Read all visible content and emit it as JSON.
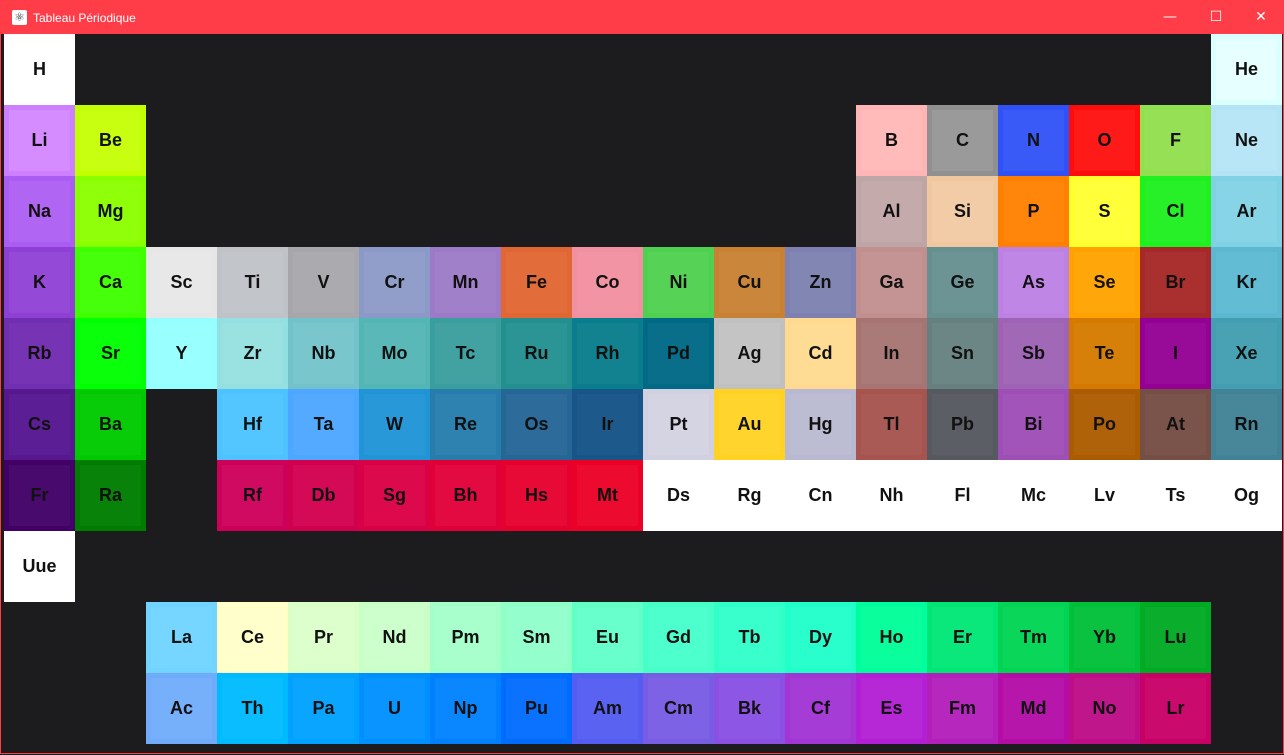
{
  "window": {
    "title": "Tableau Périodique",
    "app_icon": "atom-icon",
    "controls": {
      "minimize": "—",
      "maximize": "☐",
      "close": "✕"
    },
    "accent_color": "#ff3d49",
    "background_color": "#1c1b1e"
  },
  "elements": [
    {
      "symbol": "H",
      "color": "#ffffff",
      "inner": "#ffffff",
      "row": 1,
      "col": 1
    },
    {
      "symbol": "He",
      "color": "#d9ffff",
      "inner": "#e6ffff",
      "row": 1,
      "col": 18
    },
    {
      "symbol": "Li",
      "color": "#cc80ff",
      "inner": "#d48cff",
      "row": 2,
      "col": 1
    },
    {
      "symbol": "Be",
      "color": "#c2ff00",
      "inner": "#c8ff10",
      "row": 2,
      "col": 2
    },
    {
      "symbol": "B",
      "color": "#ffb5b5",
      "inner": "#ffbaba",
      "row": 2,
      "col": 13
    },
    {
      "symbol": "C",
      "color": "#909090",
      "inner": "#9a9a9a",
      "row": 2,
      "col": 14
    },
    {
      "symbol": "N",
      "color": "#3050f8",
      "inner": "#3a5af8",
      "row": 2,
      "col": 15
    },
    {
      "symbol": "O",
      "color": "#ff0d0d",
      "inner": "#ff1a1a",
      "row": 2,
      "col": 16
    },
    {
      "symbol": "F",
      "color": "#90e050",
      "inner": "#96e056",
      "row": 2,
      "col": 17
    },
    {
      "symbol": "Ne",
      "color": "#b3e3f5",
      "inner": "#b8e6f6",
      "row": 2,
      "col": 18
    },
    {
      "symbol": "Na",
      "color": "#ab5cf2",
      "inner": "#b066f2",
      "row": 3,
      "col": 1
    },
    {
      "symbol": "Mg",
      "color": "#8aff00",
      "inner": "#90ff0a",
      "row": 3,
      "col": 2
    },
    {
      "symbol": "Al",
      "color": "#bfa6a6",
      "inner": "#c4aaaa",
      "row": 3,
      "col": 13
    },
    {
      "symbol": "Si",
      "color": "#f0c8a0",
      "inner": "#f2cca6",
      "row": 3,
      "col": 14
    },
    {
      "symbol": "P",
      "color": "#ff8000",
      "inner": "#ff860a",
      "row": 3,
      "col": 15
    },
    {
      "symbol": "S",
      "color": "#ffff30",
      "inner": "#ffff3a",
      "row": 3,
      "col": 16
    },
    {
      "symbol": "Cl",
      "color": "#1ff01f",
      "inner": "#28f028",
      "row": 3,
      "col": 17
    },
    {
      "symbol": "Ar",
      "color": "#80d1e3",
      "inner": "#86d4e5",
      "row": 3,
      "col": 18
    },
    {
      "symbol": "K",
      "color": "#8f40d4",
      "inner": "#944ad6",
      "row": 4,
      "col": 1
    },
    {
      "symbol": "Ca",
      "color": "#3dff00",
      "inner": "#46ff0a",
      "row": 4,
      "col": 2
    },
    {
      "symbol": "Sc",
      "color": "#e6e6e6",
      "inner": "#e8e8e8",
      "row": 4,
      "col": 3
    },
    {
      "symbol": "Ti",
      "color": "#bfc2c7",
      "inner": "#c2c5ca",
      "row": 4,
      "col": 4
    },
    {
      "symbol": "V",
      "color": "#a6a6ab",
      "inner": "#aaaaaf",
      "row": 4,
      "col": 5
    },
    {
      "symbol": "Cr",
      "color": "#8a99c7",
      "inner": "#909ec9",
      "row": 4,
      "col": 6
    },
    {
      "symbol": "Mn",
      "color": "#9c7ac7",
      "inner": "#a080c9",
      "row": 4,
      "col": 7
    },
    {
      "symbol": "Fe",
      "color": "#e06633",
      "inner": "#e26c3a",
      "row": 4,
      "col": 8
    },
    {
      "symbol": "Co",
      "color": "#f090a0",
      "inner": "#f294a4",
      "row": 4,
      "col": 9
    },
    {
      "symbol": "Ni",
      "color": "#50d050",
      "inner": "#56d256",
      "row": 4,
      "col": 10
    },
    {
      "symbol": "Cu",
      "color": "#c88033",
      "inner": "#ca863a",
      "row": 4,
      "col": 11
    },
    {
      "symbol": "Zn",
      "color": "#7d80b0",
      "inner": "#8286b3",
      "row": 4,
      "col": 12
    },
    {
      "symbol": "Ga",
      "color": "#c28f8f",
      "inner": "#c49494",
      "row": 4,
      "col": 13
    },
    {
      "symbol": "Ge",
      "color": "#668f8f",
      "inner": "#6c9494",
      "row": 4,
      "col": 14
    },
    {
      "symbol": "As",
      "color": "#bd80e3",
      "inner": "#c086e5",
      "row": 4,
      "col": 15
    },
    {
      "symbol": "Se",
      "color": "#ffa100",
      "inner": "#ffa60a",
      "row": 4,
      "col": 16
    },
    {
      "symbol": "Br",
      "color": "#a62929",
      "inner": "#aa3030",
      "row": 4,
      "col": 17
    },
    {
      "symbol": "Kr",
      "color": "#5cb8d1",
      "inner": "#62bcd4",
      "row": 4,
      "col": 18
    },
    {
      "symbol": "Rb",
      "color": "#702eb0",
      "inner": "#7634b4",
      "row": 5,
      "col": 1
    },
    {
      "symbol": "Sr",
      "color": "#00ff00",
      "inner": "#0aff0a",
      "row": 5,
      "col": 2
    },
    {
      "symbol": "Y",
      "color": "#94ffff",
      "inner": "#9affff",
      "row": 5,
      "col": 3
    },
    {
      "symbol": "Zr",
      "color": "#94e0e0",
      "inner": "#9ae2e2",
      "row": 5,
      "col": 4
    },
    {
      "symbol": "Nb",
      "color": "#73c2c9",
      "inner": "#79c6cc",
      "row": 5,
      "col": 5
    },
    {
      "symbol": "Mo",
      "color": "#54b5b5",
      "inner": "#5ab8b8",
      "row": 5,
      "col": 6
    },
    {
      "symbol": "Tc",
      "color": "#3b9e9e",
      "inner": "#42a2a2",
      "row": 5,
      "col": 7
    },
    {
      "symbol": "Ru",
      "color": "#248f8f",
      "inner": "#2b9494",
      "row": 5,
      "col": 8
    },
    {
      "symbol": "Rh",
      "color": "#0a7d8c",
      "inner": "#128290",
      "row": 5,
      "col": 9
    },
    {
      "symbol": "Pd",
      "color": "#006985",
      "inner": "#086e8a",
      "row": 5,
      "col": 10
    },
    {
      "symbol": "Ag",
      "color": "#c0c0c0",
      "inner": "#c4c4c4",
      "row": 5,
      "col": 11
    },
    {
      "symbol": "Cd",
      "color": "#ffd98f",
      "inner": "#ffdc94",
      "row": 5,
      "col": 12
    },
    {
      "symbol": "In",
      "color": "#a67573",
      "inner": "#aa7a78",
      "row": 5,
      "col": 13
    },
    {
      "symbol": "Sn",
      "color": "#668080",
      "inner": "#6c8585",
      "row": 5,
      "col": 14
    },
    {
      "symbol": "Sb",
      "color": "#9e63b5",
      "inner": "#a268b8",
      "row": 5,
      "col": 15
    },
    {
      "symbol": "Te",
      "color": "#d47a00",
      "inner": "#d6800a",
      "row": 5,
      "col": 16
    },
    {
      "symbol": "I",
      "color": "#940094",
      "inner": "#980a98",
      "row": 5,
      "col": 17
    },
    {
      "symbol": "Xe",
      "color": "#429eb0",
      "inner": "#48a2b4",
      "row": 5,
      "col": 18
    },
    {
      "symbol": "Cs",
      "color": "#57178f",
      "inner": "#5c1e94",
      "row": 6,
      "col": 1
    },
    {
      "symbol": "Ba",
      "color": "#00c900",
      "inner": "#08cc08",
      "row": 6,
      "col": 2
    },
    {
      "symbol": "Hf",
      "color": "#4dc2ff",
      "inner": "#54c6ff",
      "row": 6,
      "col": 4
    },
    {
      "symbol": "Ta",
      "color": "#4da6ff",
      "inner": "#54aaff",
      "row": 6,
      "col": 5
    },
    {
      "symbol": "W",
      "color": "#2194d6",
      "inner": "#2898d8",
      "row": 6,
      "col": 6
    },
    {
      "symbol": "Re",
      "color": "#267dab",
      "inner": "#2d82b0",
      "row": 6,
      "col": 7
    },
    {
      "symbol": "Os",
      "color": "#266696",
      "inner": "#2d6b9a",
      "row": 6,
      "col": 8
    },
    {
      "symbol": "Ir",
      "color": "#175487",
      "inner": "#1e598c",
      "row": 6,
      "col": 9
    },
    {
      "symbol": "Pt",
      "color": "#d0d0e0",
      "inner": "#d4d4e2",
      "row": 6,
      "col": 10
    },
    {
      "symbol": "Au",
      "color": "#ffd123",
      "inner": "#ffd42c",
      "row": 6,
      "col": 11
    },
    {
      "symbol": "Hg",
      "color": "#b8b8d0",
      "inner": "#bcbcd3",
      "row": 6,
      "col": 12
    },
    {
      "symbol": "Tl",
      "color": "#a6544d",
      "inner": "#aa5a54",
      "row": 6,
      "col": 13
    },
    {
      "symbol": "Pb",
      "color": "#575961",
      "inner": "#5c5e66",
      "row": 6,
      "col": 14
    },
    {
      "symbol": "Bi",
      "color": "#9e4fb5",
      "inner": "#a254b8",
      "row": 6,
      "col": 15
    },
    {
      "symbol": "Po",
      "color": "#ab5c00",
      "inner": "#b0620a",
      "row": 6,
      "col": 16
    },
    {
      "symbol": "At",
      "color": "#754f45",
      "inner": "#7a544a",
      "row": 6,
      "col": 17
    },
    {
      "symbol": "Rn",
      "color": "#428296",
      "inner": "#48879a",
      "row": 6,
      "col": 18
    },
    {
      "symbol": "Fr",
      "color": "#420066",
      "inner": "#480a6c",
      "row": 7,
      "col": 1
    },
    {
      "symbol": "Ra",
      "color": "#007d00",
      "inner": "#088208",
      "row": 7,
      "col": 2
    },
    {
      "symbol": "Rf",
      "color": "#cc0059",
      "inner": "#d00a60",
      "row": 7,
      "col": 4
    },
    {
      "symbol": "Db",
      "color": "#d1004f",
      "inner": "#d40a56",
      "row": 7,
      "col": 5
    },
    {
      "symbol": "Sg",
      "color": "#d90045",
      "inner": "#dc0a4c",
      "row": 7,
      "col": 6
    },
    {
      "symbol": "Bh",
      "color": "#e00038",
      "inner": "#e20a40",
      "row": 7,
      "col": 7
    },
    {
      "symbol": "Hs",
      "color": "#e6002e",
      "inner": "#e80a36",
      "row": 7,
      "col": 8
    },
    {
      "symbol": "Mt",
      "color": "#eb0026",
      "inner": "#ec0a2e",
      "row": 7,
      "col": 9
    },
    {
      "symbol": "Ds",
      "color": "#ffffff",
      "inner": "#ffffff",
      "row": 7,
      "col": 10
    },
    {
      "symbol": "Rg",
      "color": "#ffffff",
      "inner": "#ffffff",
      "row": 7,
      "col": 11
    },
    {
      "symbol": "Cn",
      "color": "#ffffff",
      "inner": "#ffffff",
      "row": 7,
      "col": 12
    },
    {
      "symbol": "Nh",
      "color": "#ffffff",
      "inner": "#ffffff",
      "row": 7,
      "col": 13
    },
    {
      "symbol": "Fl",
      "color": "#ffffff",
      "inner": "#ffffff",
      "row": 7,
      "col": 14
    },
    {
      "symbol": "Mc",
      "color": "#ffffff",
      "inner": "#ffffff",
      "row": 7,
      "col": 15
    },
    {
      "symbol": "Lv",
      "color": "#ffffff",
      "inner": "#ffffff",
      "row": 7,
      "col": 16
    },
    {
      "symbol": "Ts",
      "color": "#ffffff",
      "inner": "#ffffff",
      "row": 7,
      "col": 17
    },
    {
      "symbol": "Og",
      "color": "#ffffff",
      "inner": "#ffffff",
      "row": 7,
      "col": 18
    },
    {
      "symbol": "Uue",
      "color": "#ffffff",
      "inner": "#ffffff",
      "row": 8,
      "col": 1
    },
    {
      "symbol": "La",
      "color": "#70d4ff",
      "inner": "#76d6ff",
      "row": 9,
      "col": 3
    },
    {
      "symbol": "Ce",
      "color": "#ffffc7",
      "inner": "#ffffcc",
      "row": 9,
      "col": 4
    },
    {
      "symbol": "Pr",
      "color": "#d9ffc7",
      "inner": "#dcffcc",
      "row": 9,
      "col": 5
    },
    {
      "symbol": "Nd",
      "color": "#c7ffc7",
      "inner": "#ccffcc",
      "row": 9,
      "col": 6
    },
    {
      "symbol": "Pm",
      "color": "#a3ffc7",
      "inner": "#a8ffcc",
      "row": 9,
      "col": 7
    },
    {
      "symbol": "Sm",
      "color": "#8fffc7",
      "inner": "#94ffcc",
      "row": 9,
      "col": 8
    },
    {
      "symbol": "Eu",
      "color": "#61ffc7",
      "inner": "#68ffcc",
      "row": 9,
      "col": 9
    },
    {
      "symbol": "Gd",
      "color": "#45ffc7",
      "inner": "#4cffcc",
      "row": 9,
      "col": 10
    },
    {
      "symbol": "Tb",
      "color": "#30ffc7",
      "inner": "#38ffcc",
      "row": 9,
      "col": 11
    },
    {
      "symbol": "Dy",
      "color": "#1fffc7",
      "inner": "#28ffcc",
      "row": 9,
      "col": 12
    },
    {
      "symbol": "Ho",
      "color": "#00ff9c",
      "inner": "#0aff9c",
      "row": 9,
      "col": 13
    },
    {
      "symbol": "Er",
      "color": "#00e675",
      "inner": "#0ae87c",
      "row": 9,
      "col": 14
    },
    {
      "symbol": "Tm",
      "color": "#00d452",
      "inner": "#0ad659",
      "row": 9,
      "col": 15
    },
    {
      "symbol": "Yb",
      "color": "#00bf38",
      "inner": "#0ac23f",
      "row": 9,
      "col": 16
    },
    {
      "symbol": "Lu",
      "color": "#00ab24",
      "inner": "#0aae2c",
      "row": 9,
      "col": 17
    },
    {
      "symbol": "Ac",
      "color": "#70abfa",
      "inner": "#76affa",
      "row": 10,
      "col": 3
    },
    {
      "symbol": "Th",
      "color": "#00baff",
      "inner": "#0abdff",
      "row": 10,
      "col": 4
    },
    {
      "symbol": "Pa",
      "color": "#00a1ff",
      "inner": "#0aa5ff",
      "row": 10,
      "col": 5
    },
    {
      "symbol": "U",
      "color": "#008fff",
      "inner": "#0a94ff",
      "row": 10,
      "col": 6
    },
    {
      "symbol": "Np",
      "color": "#0080ff",
      "inner": "#0a86ff",
      "row": 10,
      "col": 7
    },
    {
      "symbol": "Pu",
      "color": "#006bff",
      "inner": "#0a72ff",
      "row": 10,
      "col": 8
    },
    {
      "symbol": "Am",
      "color": "#545cf2",
      "inner": "#5a62f2",
      "row": 10,
      "col": 9
    },
    {
      "symbol": "Cm",
      "color": "#785ce3",
      "inner": "#7e62e5",
      "row": 10,
      "col": 10
    },
    {
      "symbol": "Bk",
      "color": "#8a4fe3",
      "inner": "#8e56e5",
      "row": 10,
      "col": 11
    },
    {
      "symbol": "Cf",
      "color": "#a136d4",
      "inner": "#a53cd6",
      "row": 10,
      "col": 12
    },
    {
      "symbol": "Es",
      "color": "#b31fd4",
      "inner": "#b628d6",
      "row": 10,
      "col": 13
    },
    {
      "symbol": "Fm",
      "color": "#b31fba",
      "inner": "#b628bd",
      "row": 10,
      "col": 14
    },
    {
      "symbol": "Md",
      "color": "#b30da6",
      "inner": "#b616aa",
      "row": 10,
      "col": 15
    },
    {
      "symbol": "No",
      "color": "#bd0d87",
      "inner": "#c0168c",
      "row": 10,
      "col": 16
    },
    {
      "symbol": "Lr",
      "color": "#c70066",
      "inner": "#ca0a6c",
      "row": 10,
      "col": 17
    }
  ]
}
